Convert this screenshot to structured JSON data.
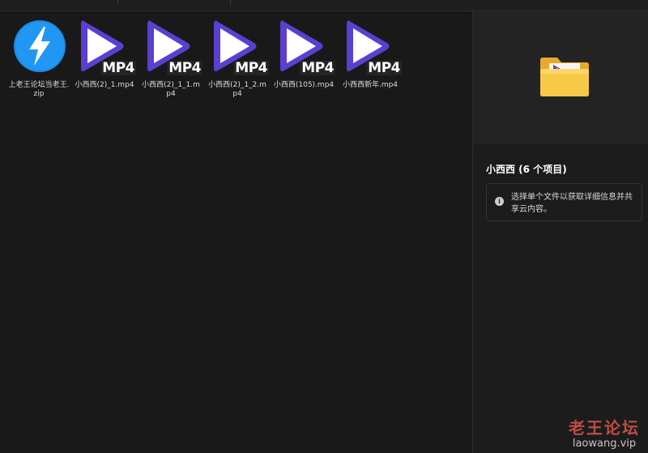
{
  "files": [
    {
      "name": "上老王论坛当老王.zip",
      "icon": "bandizip-zip-icon",
      "type": "zip"
    },
    {
      "name": "小西西(2)_1.mp4",
      "icon": "mp4-video-icon",
      "type": "mp4",
      "badge": "MP4"
    },
    {
      "name": "小西西(2)_1_1.mp4",
      "icon": "mp4-video-icon",
      "type": "mp4",
      "badge": "MP4"
    },
    {
      "name": "小西西(2)_1_2.mp4",
      "icon": "mp4-video-icon",
      "type": "mp4",
      "badge": "MP4"
    },
    {
      "name": "小西西(105).mp4",
      "icon": "mp4-video-icon",
      "type": "mp4",
      "badge": "MP4"
    },
    {
      "name": "小西西新年.mp4",
      "icon": "mp4-video-icon",
      "type": "mp4",
      "badge": "MP4"
    }
  ],
  "details": {
    "title": "小西西 (6 个项目)",
    "info_text": "选择单个文件以获取详细信息并共享云内容。",
    "preview_icon": "folder-icon"
  },
  "watermark": {
    "cn": "老王论坛",
    "en": "laowang.vip"
  },
  "colors": {
    "background": "#191919",
    "panel": "#1c1c1c",
    "play_purple": "#5b3fd0",
    "zip_blue": "#1e88e5",
    "folder_yellow": "#f5c64a"
  }
}
